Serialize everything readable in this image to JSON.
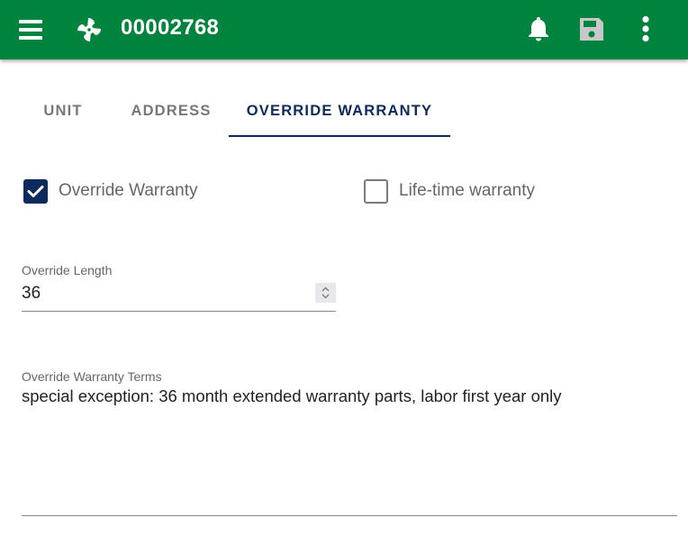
{
  "appbar": {
    "title": "00002768",
    "icons": [
      "menu-icon",
      "fan-logo-icon",
      "bell-icon",
      "save-icon",
      "more-vert-icon"
    ],
    "colors": {
      "background": "#00843d",
      "save_icon_disabled": "#c8c8c8"
    }
  },
  "tabs": [
    {
      "label": "UNIT",
      "active": false
    },
    {
      "label": "ADDRESS",
      "active": false
    },
    {
      "label": "OVERRIDE WARRANTY",
      "active": true
    }
  ],
  "form": {
    "override_warranty": {
      "label": "Override Warranty",
      "checked": true
    },
    "lifetime_warranty": {
      "label": "Life-time warranty",
      "checked": false
    },
    "override_length": {
      "label": "Override Length",
      "value": "36"
    },
    "override_terms": {
      "label": "Override Warranty Terms",
      "value": "special exception: 36 month extended warranty parts, labor first year only"
    }
  },
  "colors": {
    "accent": "#0d2a5c",
    "tab_inactive": "#777777"
  }
}
